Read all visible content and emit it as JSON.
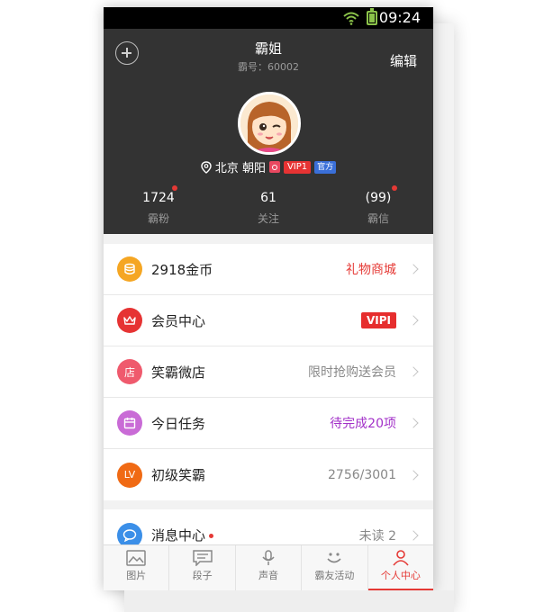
{
  "status": {
    "time": "09:24"
  },
  "header": {
    "title": "霸姐",
    "id_text": "霸号：60002",
    "edit_label": "编辑",
    "location": "北京 朝阳",
    "vip_badge": "VIP1",
    "official_badge": "官方",
    "stats": [
      {
        "value": "1724",
        "label": "霸粉",
        "has_dot": true
      },
      {
        "value": "61",
        "label": "关注",
        "has_dot": false
      },
      {
        "value": "(99)",
        "label": "霸信",
        "has_dot": true
      }
    ]
  },
  "menu": [
    {
      "icon": "coin-icon",
      "icon_color": "#f5a623",
      "label": "2918金币",
      "right": "礼物商城",
      "right_color": "#e53935"
    },
    {
      "icon": "crown-icon",
      "icon_color": "#e63333",
      "label": "会员中心",
      "right": "VIPI",
      "right_color": "#e62e2e"
    },
    {
      "icon": "shop-icon",
      "icon_color": "#ef5a6d",
      "label": "笑霸微店",
      "icon_text": "店",
      "right": "限时抢购送会员",
      "right_color": "#888888"
    },
    {
      "icon": "calendar-icon",
      "icon_color": "#c96bd6",
      "label": "今日任务",
      "right": "待完成20项",
      "right_color": "#a230c8"
    },
    {
      "icon": "level-icon",
      "icon_color": "#f06a14",
      "label": "初级笑霸",
      "icon_text": "LV",
      "right": "2756/3001",
      "right_color": "#888888"
    }
  ],
  "messages": {
    "icon": "chat-icon",
    "icon_color": "#3b8fe8",
    "label": "消息中心",
    "right": "未读 2",
    "right_color": "#888888"
  },
  "nav": [
    {
      "label": "图片",
      "icon": "image-icon",
      "active": false
    },
    {
      "label": "段子",
      "icon": "text-icon",
      "active": false
    },
    {
      "label": "声音",
      "icon": "mic-icon",
      "active": false
    },
    {
      "label": "霸友活动",
      "icon": "smile-icon",
      "active": false
    },
    {
      "label": "个人中心",
      "icon": "person-icon",
      "active": true
    }
  ]
}
